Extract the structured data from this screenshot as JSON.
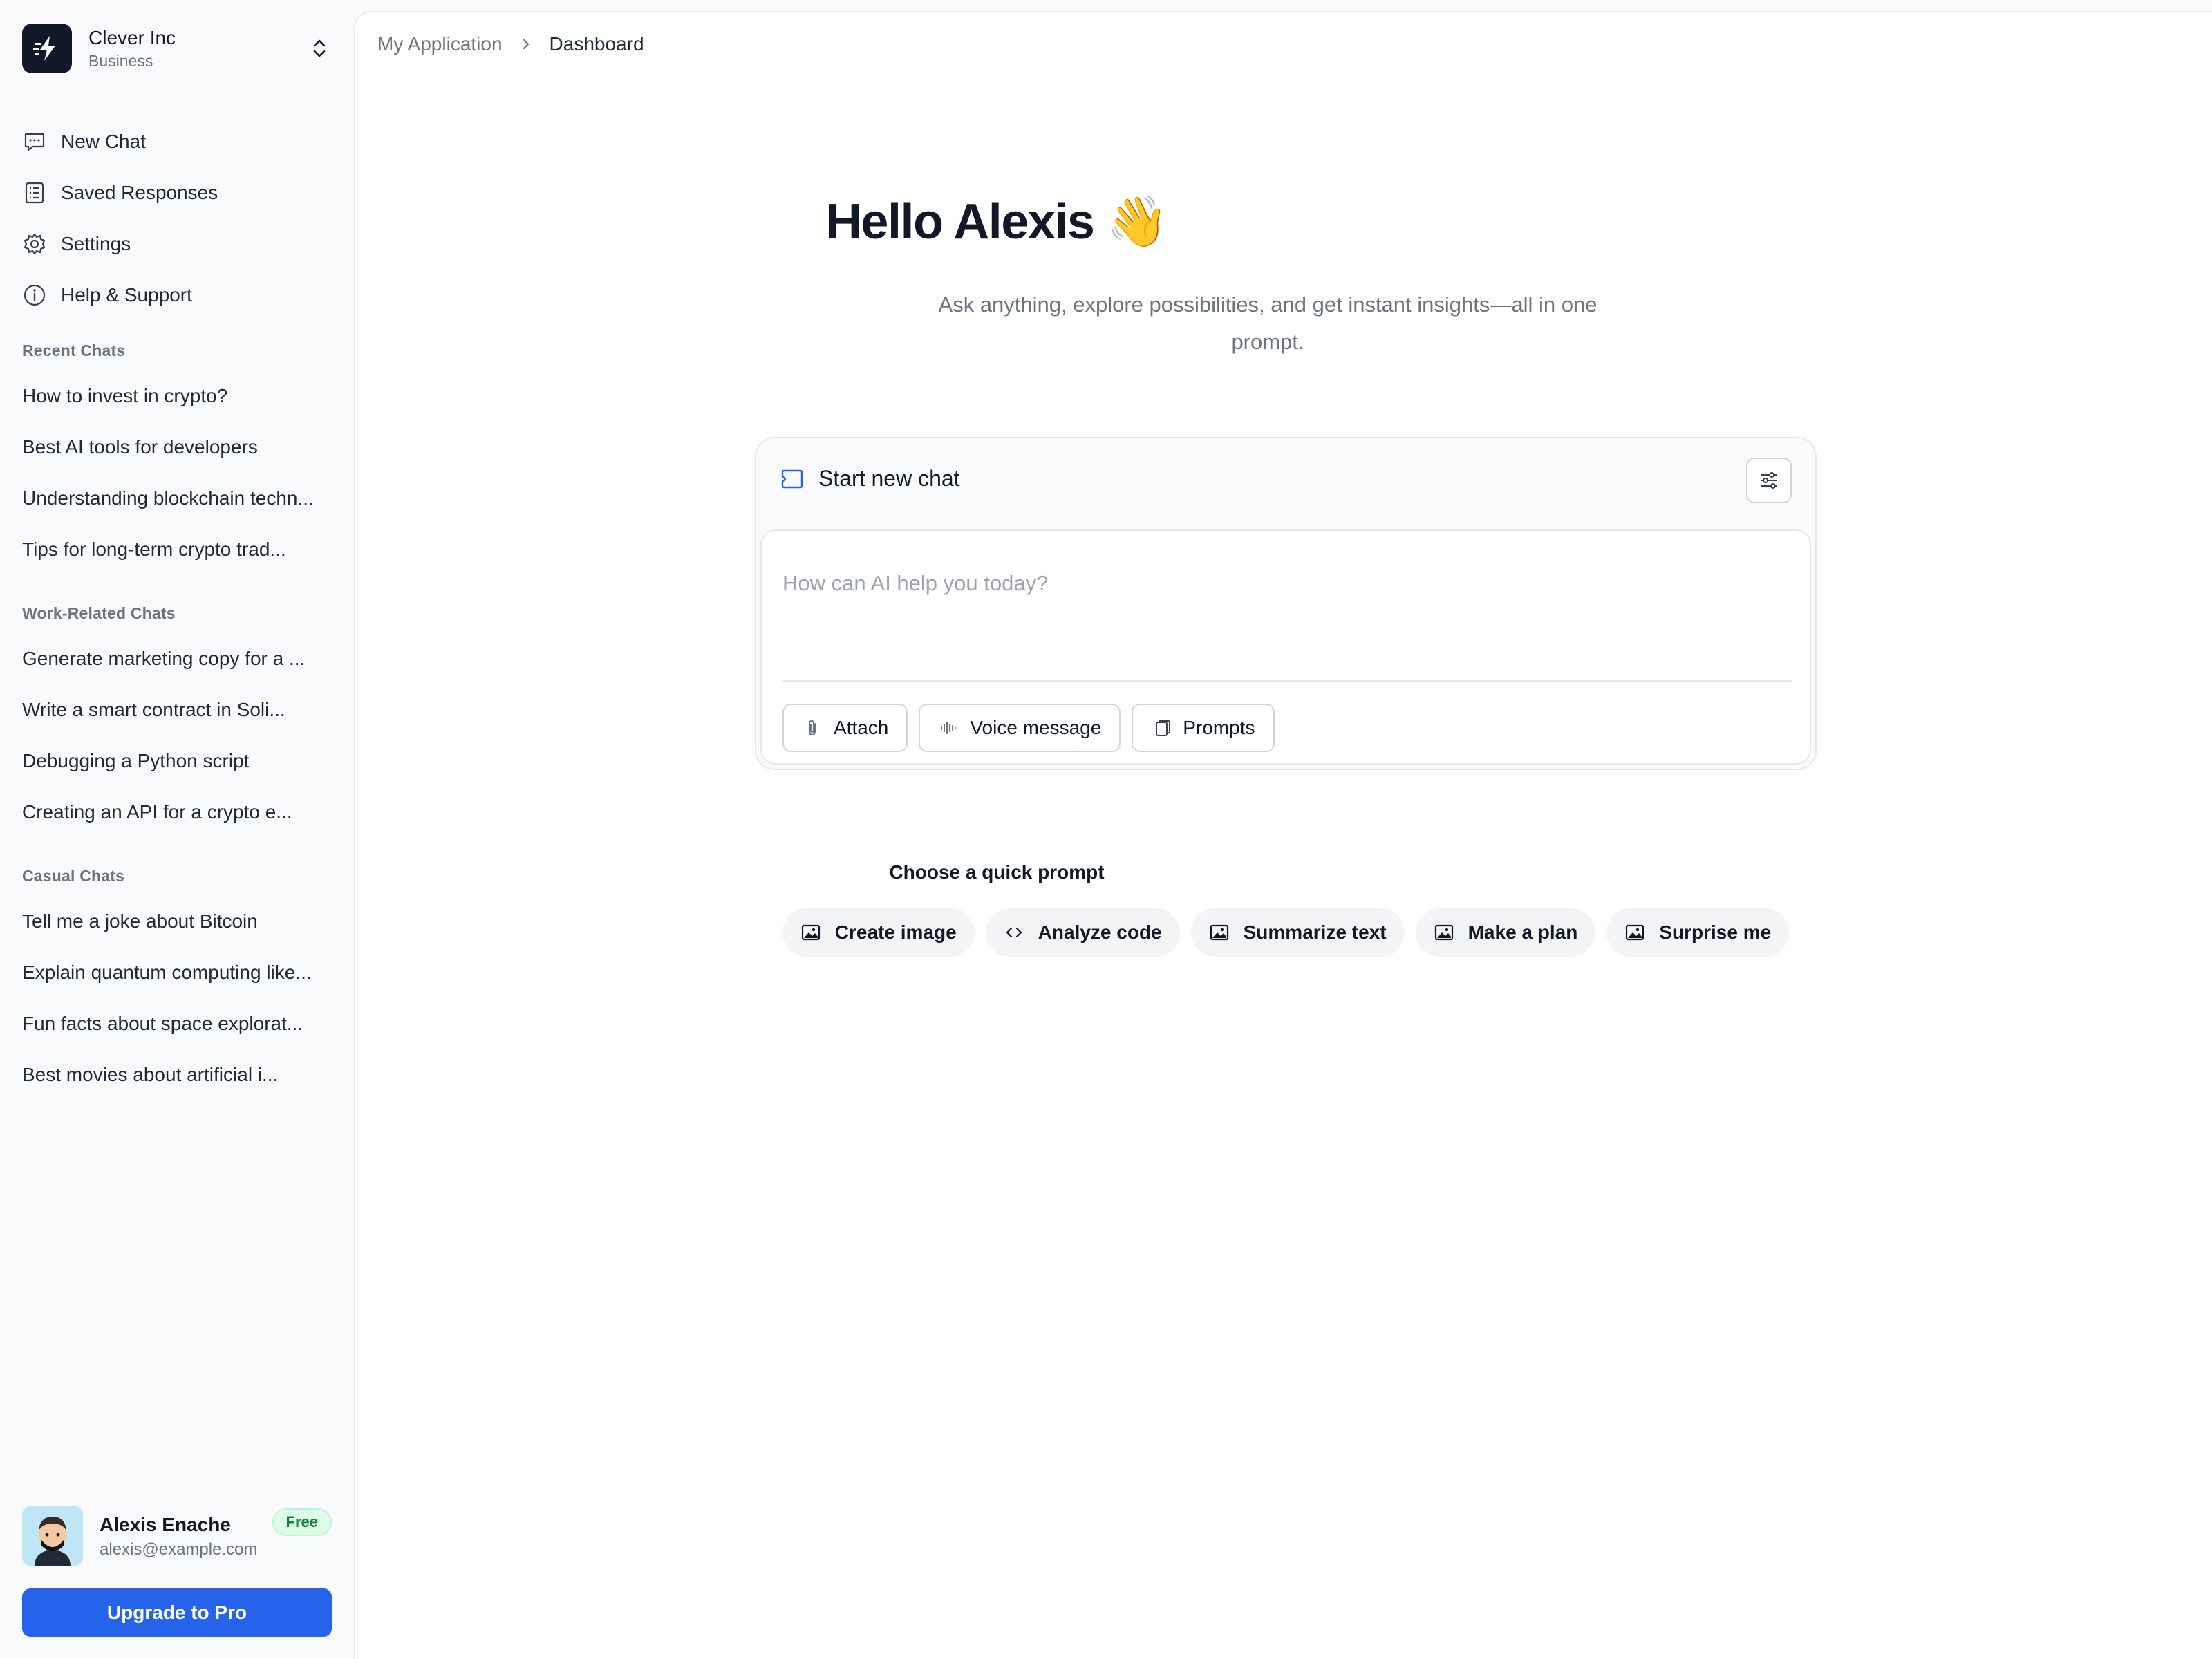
{
  "sidebar": {
    "org": {
      "name": "Clever Inc",
      "plan": "Business"
    },
    "nav": [
      {
        "label": "New Chat",
        "icon": "message-square-icon"
      },
      {
        "label": "Saved Responses",
        "icon": "document-list-icon"
      },
      {
        "label": "Settings",
        "icon": "gear-icon"
      },
      {
        "label": "Help & Support",
        "icon": "info-icon"
      }
    ],
    "sections": [
      {
        "label": "Recent Chats",
        "items": [
          "How to invest in crypto?",
          "Best AI tools for developers",
          "Understanding blockchain techn...",
          "Tips for long-term crypto trad..."
        ]
      },
      {
        "label": "Work-Related Chats",
        "items": [
          "Generate marketing copy for a ...",
          "Write a smart contract in Soli...",
          "Debugging a Python script",
          "Creating an API for a crypto e..."
        ]
      },
      {
        "label": "Casual Chats",
        "items": [
          "Tell me a joke about Bitcoin",
          "Explain quantum computing like...",
          "Fun facts about space explorat...",
          "Best movies about artificial i..."
        ]
      }
    ],
    "user": {
      "name": "Alexis Enache",
      "email": "alexis@example.com",
      "badge": "Free"
    },
    "upgrade_label": "Upgrade to Pro"
  },
  "breadcrumb": {
    "parent": "My Application",
    "current": "Dashboard"
  },
  "hero": {
    "greeting": "Hello Alexis 👋",
    "subtitle": "Ask anything, explore possibilities, and get instant insights—all in one prompt."
  },
  "chatbox": {
    "title": "Start new chat",
    "placeholder": "How can AI help you today?",
    "tools": [
      {
        "label": "Attach",
        "icon": "paperclip-icon"
      },
      {
        "label": "Voice message",
        "icon": "waveform-icon"
      },
      {
        "label": "Prompts",
        "icon": "copy-icon"
      }
    ]
  },
  "quick": {
    "label": "Choose a quick prompt",
    "chips": [
      {
        "label": "Create image",
        "icon": "image-icon"
      },
      {
        "label": "Analyze code",
        "icon": "code-icon"
      },
      {
        "label": "Summarize text",
        "icon": "image-icon"
      },
      {
        "label": "Make a plan",
        "icon": "image-icon"
      },
      {
        "label": "Surprise me",
        "icon": "image-icon"
      }
    ]
  },
  "colors": {
    "accent": "#2563eb",
    "badge_bg": "#dcfce7",
    "badge_text": "#15803d"
  }
}
